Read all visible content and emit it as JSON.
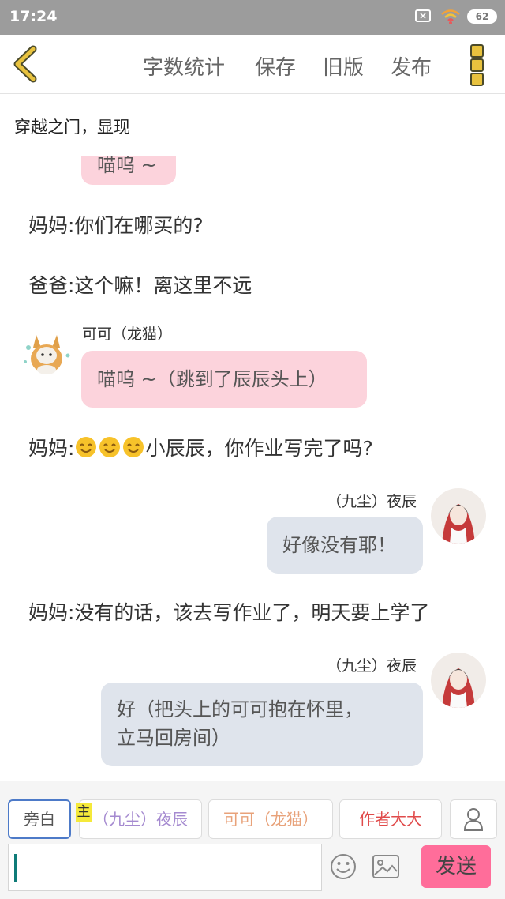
{
  "status": {
    "time": "17:24",
    "battery": "62"
  },
  "toolbar": {
    "word_count": "字数统计",
    "save": "保存",
    "old_version": "旧版",
    "publish": "发布"
  },
  "chapter": {
    "title": "穿越之门，显现"
  },
  "messages": {
    "m0": "喵呜 ~",
    "m1": "妈妈:你们在哪买的?",
    "m2": "爸爸:这个嘛！离这里不远",
    "m3_sender": "可可（龙猫）",
    "m3": "喵呜 ~（跳到了辰辰头上）",
    "m4_prefix": "妈妈:",
    "m4_suffix": "小辰辰，你作业写完了吗?",
    "m5_sender": "（九尘）夜辰",
    "m5": "好像没有耶！",
    "m6": "妈妈:没有的话，该去写作业了，明天要上学了",
    "m7_sender": "（九尘）夜辰",
    "m7_line1": "好（把头上的可可抱在怀里，",
    "m7_line2": "立马回房间）"
  },
  "roles": {
    "narrator": "旁白",
    "host_badge": "主",
    "jiuchen": "（九尘）夜辰",
    "keke": "可可（龙猫）",
    "author": "作者大大"
  },
  "input": {
    "value": "",
    "send": "发送"
  },
  "colors": {
    "accent_pink": "#ff6d9a",
    "bubble_pink": "#fcd3dc",
    "bubble_gray": "#dfe4ec",
    "back_arrow": "#e8c23e"
  }
}
